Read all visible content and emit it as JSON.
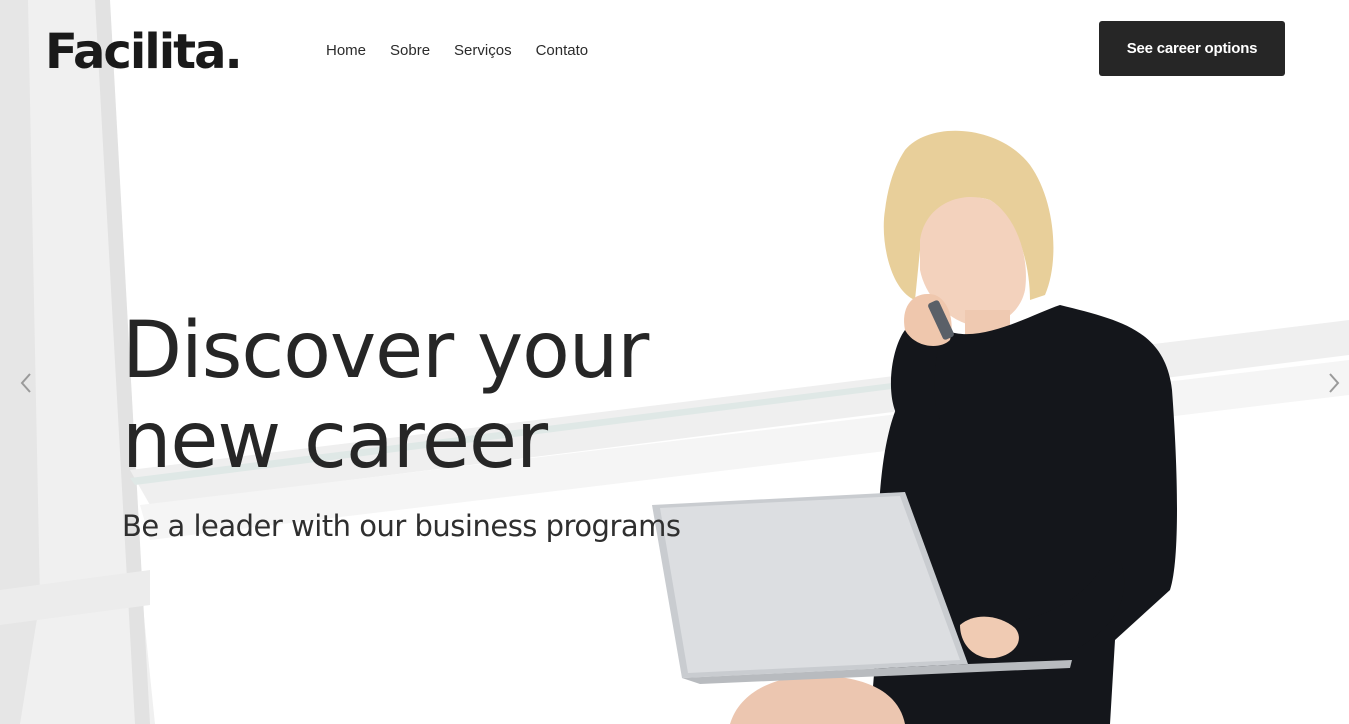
{
  "brand": {
    "logo_text": "Facilita."
  },
  "nav": {
    "items": [
      {
        "label": "Home"
      },
      {
        "label": "Sobre"
      },
      {
        "label": "Serviços"
      },
      {
        "label": "Contato"
      }
    ]
  },
  "header": {
    "cta_label": "See career options"
  },
  "hero": {
    "headline_line1": "Discover your",
    "headline_line2": "new career",
    "subheadline": "Be a leader with our business programs"
  },
  "carousel": {
    "prev_icon": "chevron-left-icon",
    "next_icon": "chevron-right-icon"
  },
  "colors": {
    "cta_background": "#262626",
    "text_dark": "#262626",
    "page_background": "#ffffff"
  }
}
